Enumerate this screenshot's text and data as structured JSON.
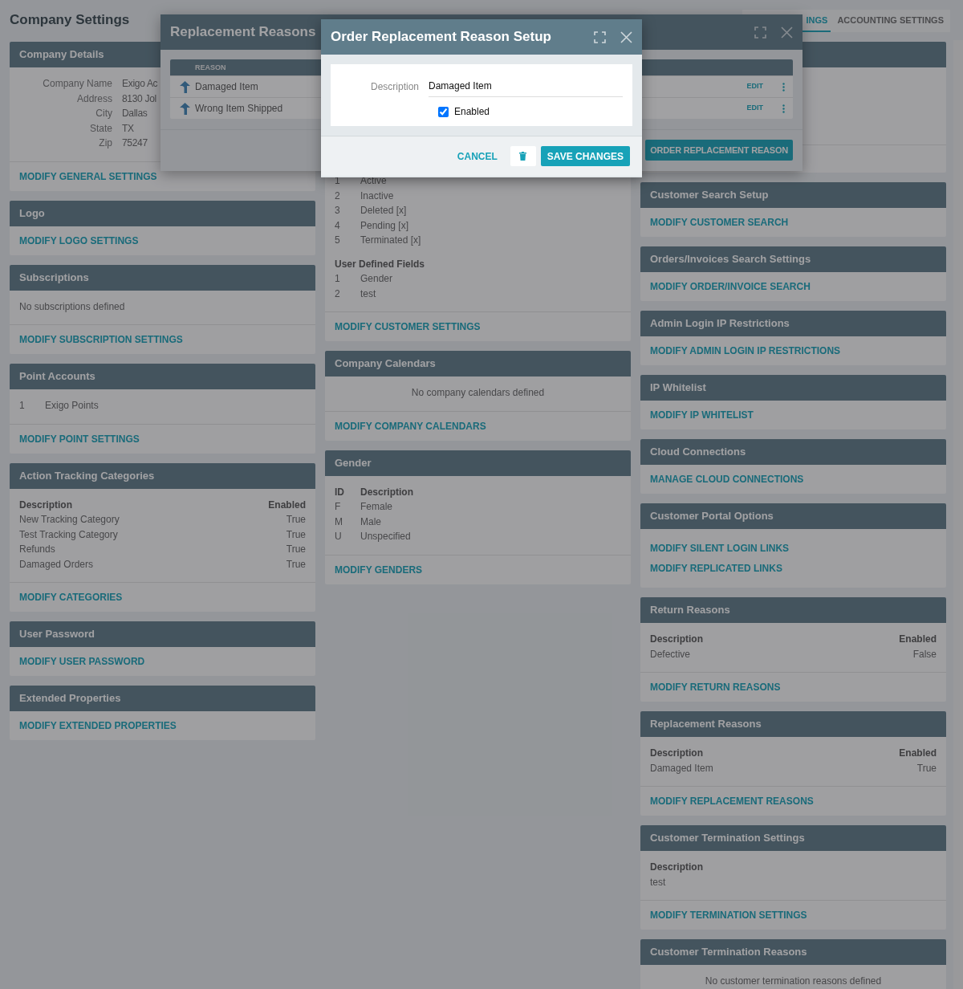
{
  "page": {
    "title": "Company Settings",
    "tabs": [
      {
        "label": "INGS",
        "selected": true
      },
      {
        "label": "ACCOUNTING SETTINGS",
        "selected": false
      }
    ]
  },
  "columns": [
    [
      {
        "title": "Company Details",
        "blocks": [
          {
            "kind": "pairs",
            "rows": [
              [
                "Company Name",
                "Exigo Ac"
              ],
              [
                "Address",
                "8130 Jol"
              ],
              [
                "City",
                "Dallas"
              ],
              [
                "State",
                "TX"
              ],
              [
                "Zip",
                "75247"
              ]
            ]
          }
        ],
        "links": [
          "MODIFY GENERAL SETTINGS"
        ]
      },
      {
        "title": "Logo",
        "links": [
          "MODIFY LOGO SETTINGS"
        ]
      },
      {
        "title": "Subscriptions",
        "blocks": [
          {
            "kind": "message",
            "text": "No subscriptions defined",
            "centered": false
          }
        ],
        "links": [
          "MODIFY SUBSCRIPTION SETTINGS"
        ]
      },
      {
        "title": "Point Accounts",
        "blocks": [
          {
            "kind": "list",
            "rows": [
              [
                "1",
                "Exigo Points"
              ]
            ]
          }
        ],
        "links": [
          "MODIFY POINT SETTINGS"
        ]
      },
      {
        "title": "Action Tracking Categories",
        "blocks": [
          {
            "kind": "table",
            "columns": [
              "Description",
              "Enabled"
            ],
            "rows": [
              [
                "New Tracking Category",
                "True"
              ],
              [
                "Test Tracking Category",
                "True"
              ],
              [
                "Refunds",
                "True"
              ],
              [
                "Damaged Orders",
                "True"
              ]
            ]
          }
        ],
        "links": [
          "MODIFY CATEGORIES"
        ]
      },
      {
        "title": "User Password",
        "links": [
          "MODIFY USER PASSWORD"
        ]
      },
      {
        "title": "Extended Properties",
        "links": [
          "MODIFY EXTENDED PROPERTIES"
        ]
      }
    ],
    [
      {
        "blocks": [
          {
            "kind": "list",
            "rows": [
              [
                "1",
                "Active"
              ],
              [
                "2",
                "Inactive"
              ],
              [
                "3",
                "Deleted [x]"
              ],
              [
                "4",
                "Pending [x]"
              ],
              [
                "5",
                "Terminated [x]"
              ]
            ]
          },
          {
            "kind": "list",
            "heading": "User Defined Fields",
            "rows": [
              [
                "1",
                "Gender"
              ],
              [
                "2",
                "test"
              ]
            ]
          }
        ],
        "links": [
          "MODIFY CUSTOMER SETTINGS"
        ]
      },
      {
        "title": "Company Calendars",
        "blocks": [
          {
            "kind": "message",
            "text": "No company calendars defined",
            "centered": true
          }
        ],
        "links": [
          "MODIFY COMPANY CALENDARS"
        ]
      },
      {
        "title": "Gender",
        "blocks": [
          {
            "kind": "list",
            "columns": [
              "ID",
              "Description"
            ],
            "rows": [
              [
                "F",
                "Female"
              ],
              [
                "M",
                "Male"
              ],
              [
                "U",
                "Unspecified"
              ]
            ]
          }
        ],
        "links": [
          "MODIFY GENDERS"
        ]
      }
    ],
    [
      {
        "kind": "covered"
      },
      {
        "title": "Customer Search Setup",
        "links": [
          "MODIFY CUSTOMER SEARCH"
        ]
      },
      {
        "title": "Orders/Invoices Search Settings",
        "links": [
          "MODIFY ORDER/INVOICE SEARCH"
        ]
      },
      {
        "title": "Admin Login IP Restrictions",
        "links": [
          "MODIFY ADMIN LOGIN IP RESTRICTIONS"
        ]
      },
      {
        "title": "IP Whitelist",
        "links": [
          "MODIFY IP WHITELIST"
        ]
      },
      {
        "title": "Cloud Connections",
        "links": [
          "MANAGE CLOUD CONNECTIONS"
        ]
      },
      {
        "title": "Customer Portal Options",
        "links": [
          "MODIFY SILENT LOGIN LINKS",
          "MODIFY REPLICATED LINKS"
        ]
      },
      {
        "title": "Return Reasons",
        "blocks": [
          {
            "kind": "table",
            "columns": [
              "Description",
              "Enabled"
            ],
            "rows": [
              [
                "Defective",
                "False"
              ]
            ]
          }
        ],
        "links": [
          "MODIFY RETURN REASONS"
        ]
      },
      {
        "title": "Replacement Reasons",
        "blocks": [
          {
            "kind": "table",
            "columns": [
              "Description",
              "Enabled"
            ],
            "rows": [
              [
                "Damaged Item",
                "True"
              ]
            ]
          }
        ],
        "links": [
          "MODIFY REPLACEMENT REASONS"
        ]
      },
      {
        "title": "Customer Termination Settings",
        "blocks": [
          {
            "kind": "list",
            "heading": "Description",
            "rows": [
              [
                "test"
              ]
            ]
          }
        ],
        "links": [
          "MODIFY TERMINATION SETTINGS"
        ]
      },
      {
        "title": "Customer Termination Reasons",
        "blocks": [
          {
            "kind": "message",
            "text": "No customer termination reasons defined",
            "centered": true
          }
        ]
      }
    ]
  ],
  "reasons_dialog": {
    "title": "Replacement Reasons",
    "column": "REASON",
    "rows": [
      {
        "reason": "Damaged Item",
        "action": "EDIT"
      },
      {
        "reason": "Wrong Item Shipped",
        "action": "EDIT"
      }
    ],
    "add_button": "ORDER REPLACEMENT REASON"
  },
  "setup_dialog": {
    "title": "Order Replacement Reason Setup",
    "description": {
      "label": "Description",
      "value": "Damaged Item"
    },
    "enabled": {
      "label": "Enabled",
      "checked": true
    },
    "cancel": "CANCEL",
    "save": "SAVE CHANGES"
  }
}
